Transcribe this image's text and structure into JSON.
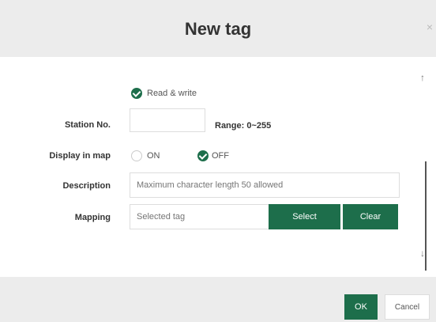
{
  "dialog": {
    "title": "New tag",
    "close_glyph": "×"
  },
  "form": {
    "access": {
      "label": "Read & write",
      "selected": true
    },
    "station_no": {
      "label": "Station No.",
      "value": "",
      "range_text": "Range: 0~255"
    },
    "display_in_map": {
      "label": "Display in map",
      "options": [
        {
          "label": "ON",
          "selected": false
        },
        {
          "label": "OFF",
          "selected": true
        }
      ]
    },
    "description": {
      "label": "Description",
      "placeholder": "Maximum character length 50 allowed",
      "value": ""
    },
    "mapping": {
      "label": "Mapping",
      "placeholder": "Selected tag",
      "select_label": "Select",
      "clear_label": "Clear"
    }
  },
  "scroll": {
    "up_glyph": "↑",
    "down_glyph": "↓"
  },
  "footer": {
    "ok_label": "OK",
    "cancel_label": "Cancel"
  },
  "colors": {
    "accent": "#1d6e4b",
    "header_bg": "#ececec"
  }
}
